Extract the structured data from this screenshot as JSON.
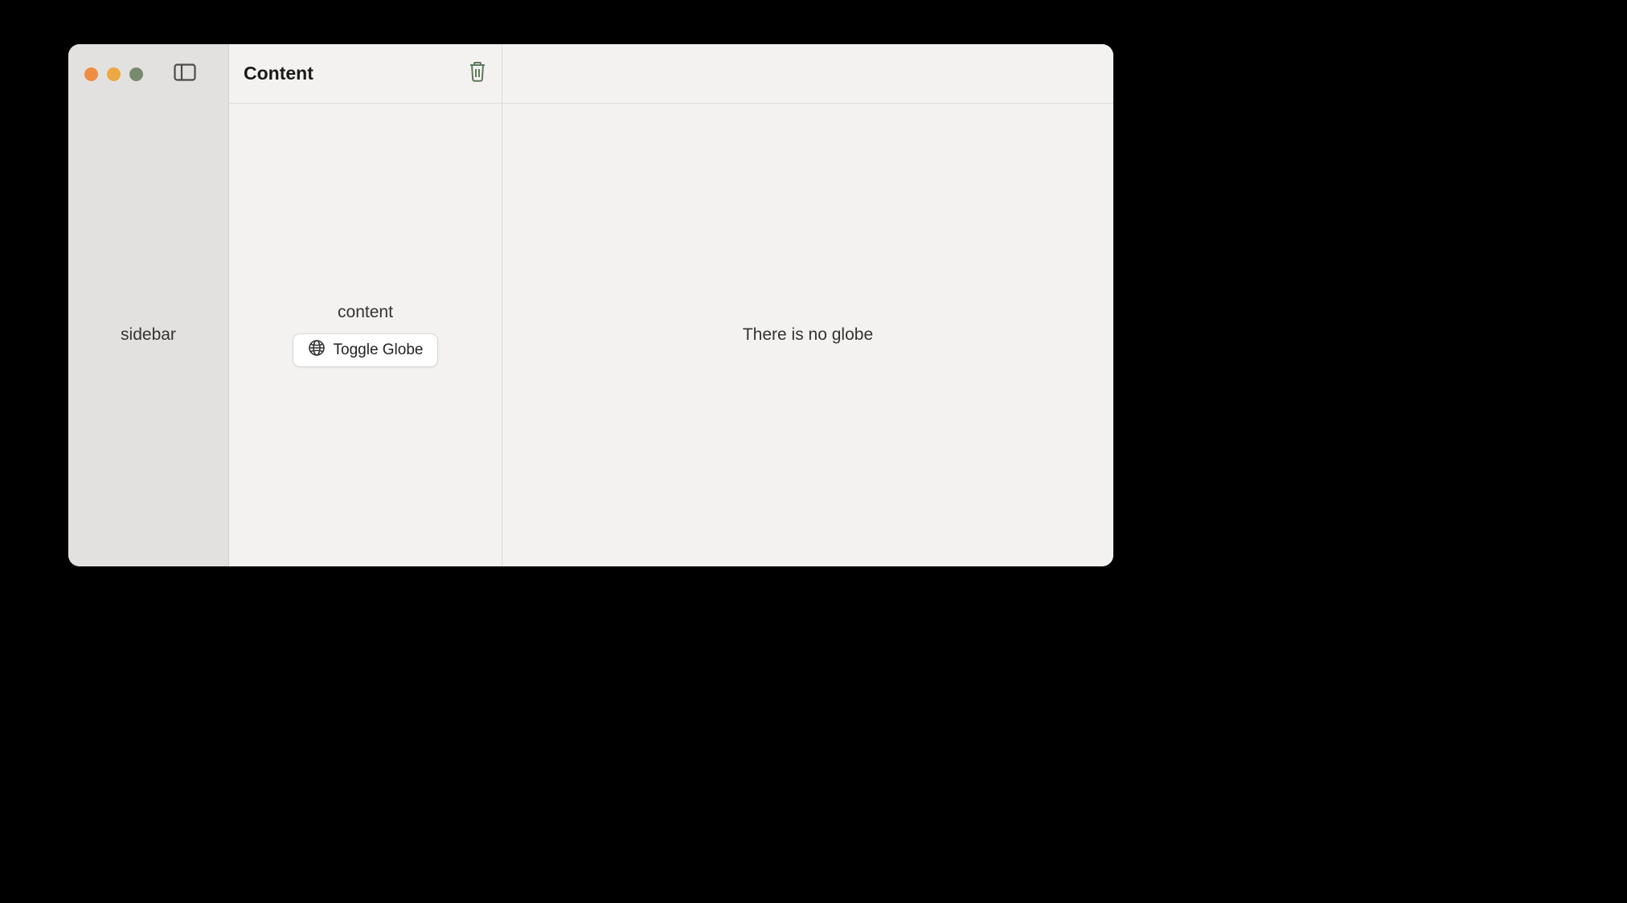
{
  "sidebar": {
    "label": "sidebar"
  },
  "content": {
    "title": "Content",
    "body_label": "content",
    "toggle_label": "Toggle Globe"
  },
  "detail": {
    "empty_text": "There is no globe"
  }
}
